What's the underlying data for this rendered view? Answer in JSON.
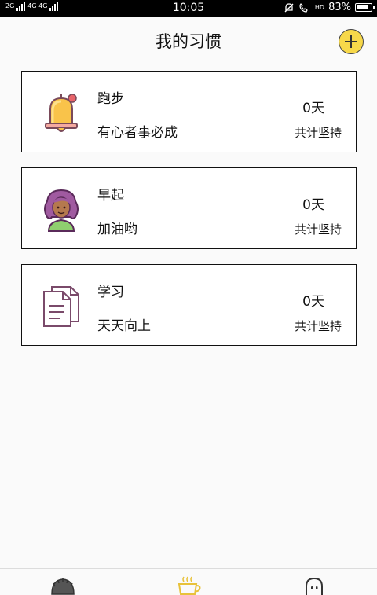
{
  "status_bar": {
    "network_left": "2G",
    "network_mid": "4G 4G",
    "time": "10:05",
    "hd": "HD",
    "battery": "83%",
    "battery_level": 0.83
  },
  "header": {
    "title": "我的习惯",
    "add_icon": "plus-circle-icon"
  },
  "habits": [
    {
      "name": "跑步",
      "motto": "有心者事必成",
      "days": "0天",
      "total_label": "共计坚持",
      "icon": "bell-icon"
    },
    {
      "name": "早起",
      "motto": "加油哟",
      "days": "0天",
      "total_label": "共计坚持",
      "icon": "girl-avatar-icon"
    },
    {
      "name": "学习",
      "motto": "天天向上",
      "days": "0天",
      "total_label": "共计坚持",
      "icon": "document-icon"
    }
  ],
  "bottom_nav": {
    "items": [
      {
        "icon": "hedgehog-icon"
      },
      {
        "icon": "coffee-cup-icon",
        "active": true
      },
      {
        "icon": "chat-bubble-icon"
      }
    ]
  },
  "colors": {
    "accent": "#f7d84a",
    "card_border": "#111111",
    "background": "#fafafa"
  }
}
